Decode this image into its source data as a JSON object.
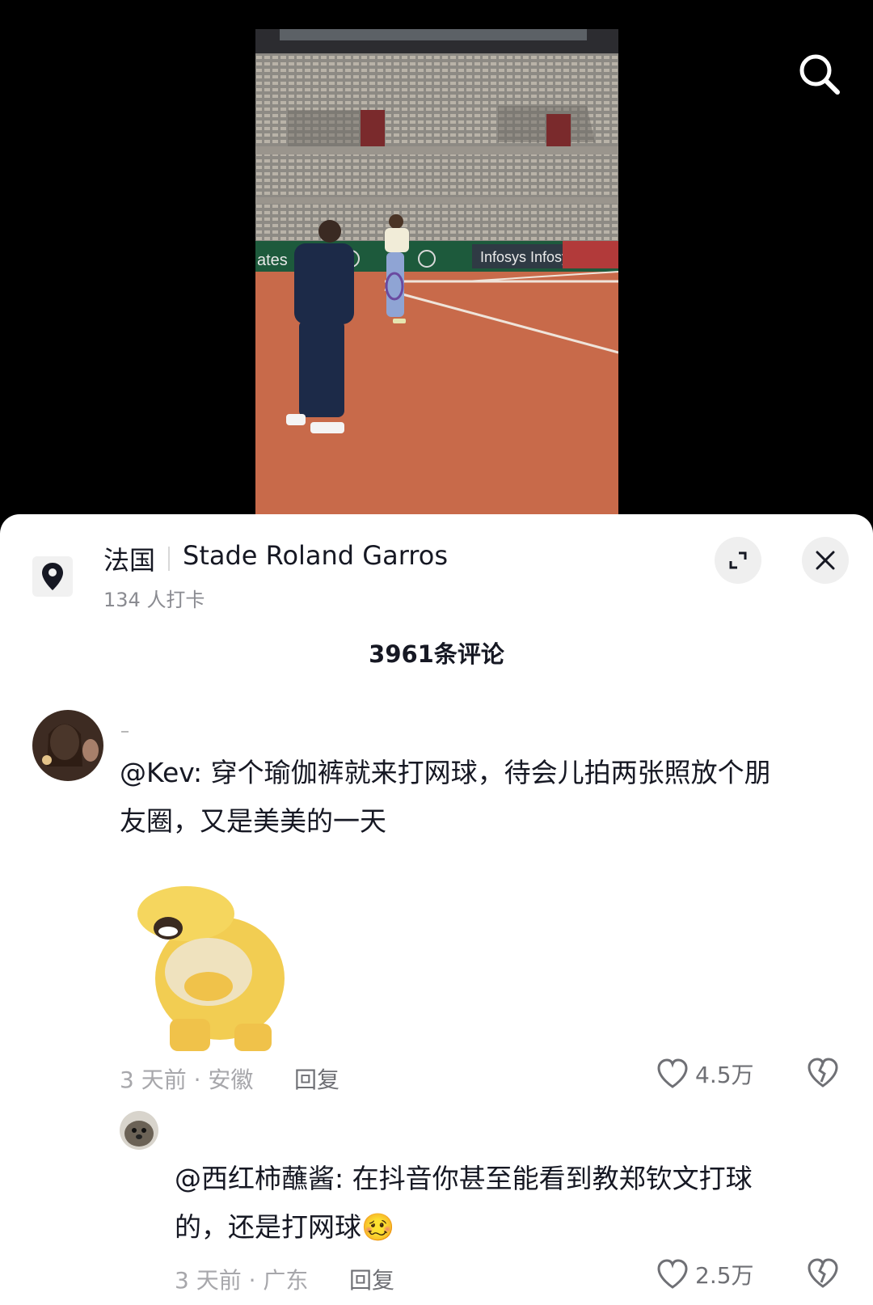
{
  "location": {
    "country": "法国",
    "place": "Stade Roland Garros",
    "checkins": "134 人打卡"
  },
  "comments_header": {
    "count": "3961条评论"
  },
  "comments": [
    {
      "text_line1": "@Kev: 穿个瑜伽裤就来打网球，待会儿拍两张照放个朋",
      "text_line2": "友圈，又是美美的一天",
      "time_region": "3 天前 · 安徽",
      "reply_label": "回复",
      "likes": "4.5万"
    },
    {
      "text_line1": "@西红柿蘸酱: 在抖音你甚至能看到教郑钦文打球",
      "text_line2": "的，还是打网球",
      "emoji": "🥴",
      "time_region": "3 天前 · 广东",
      "reply_label": "回复",
      "likes": "2.5万"
    }
  ],
  "icons": {
    "search": "search-icon",
    "location": "location-pin-icon",
    "expand": "expand-icon",
    "close": "close-icon",
    "like": "heart-icon",
    "dislike": "broken-heart-icon"
  },
  "colors": {
    "clay": "#c86a4a",
    "text_primary": "#161823",
    "text_secondary": "#8a8b91"
  }
}
